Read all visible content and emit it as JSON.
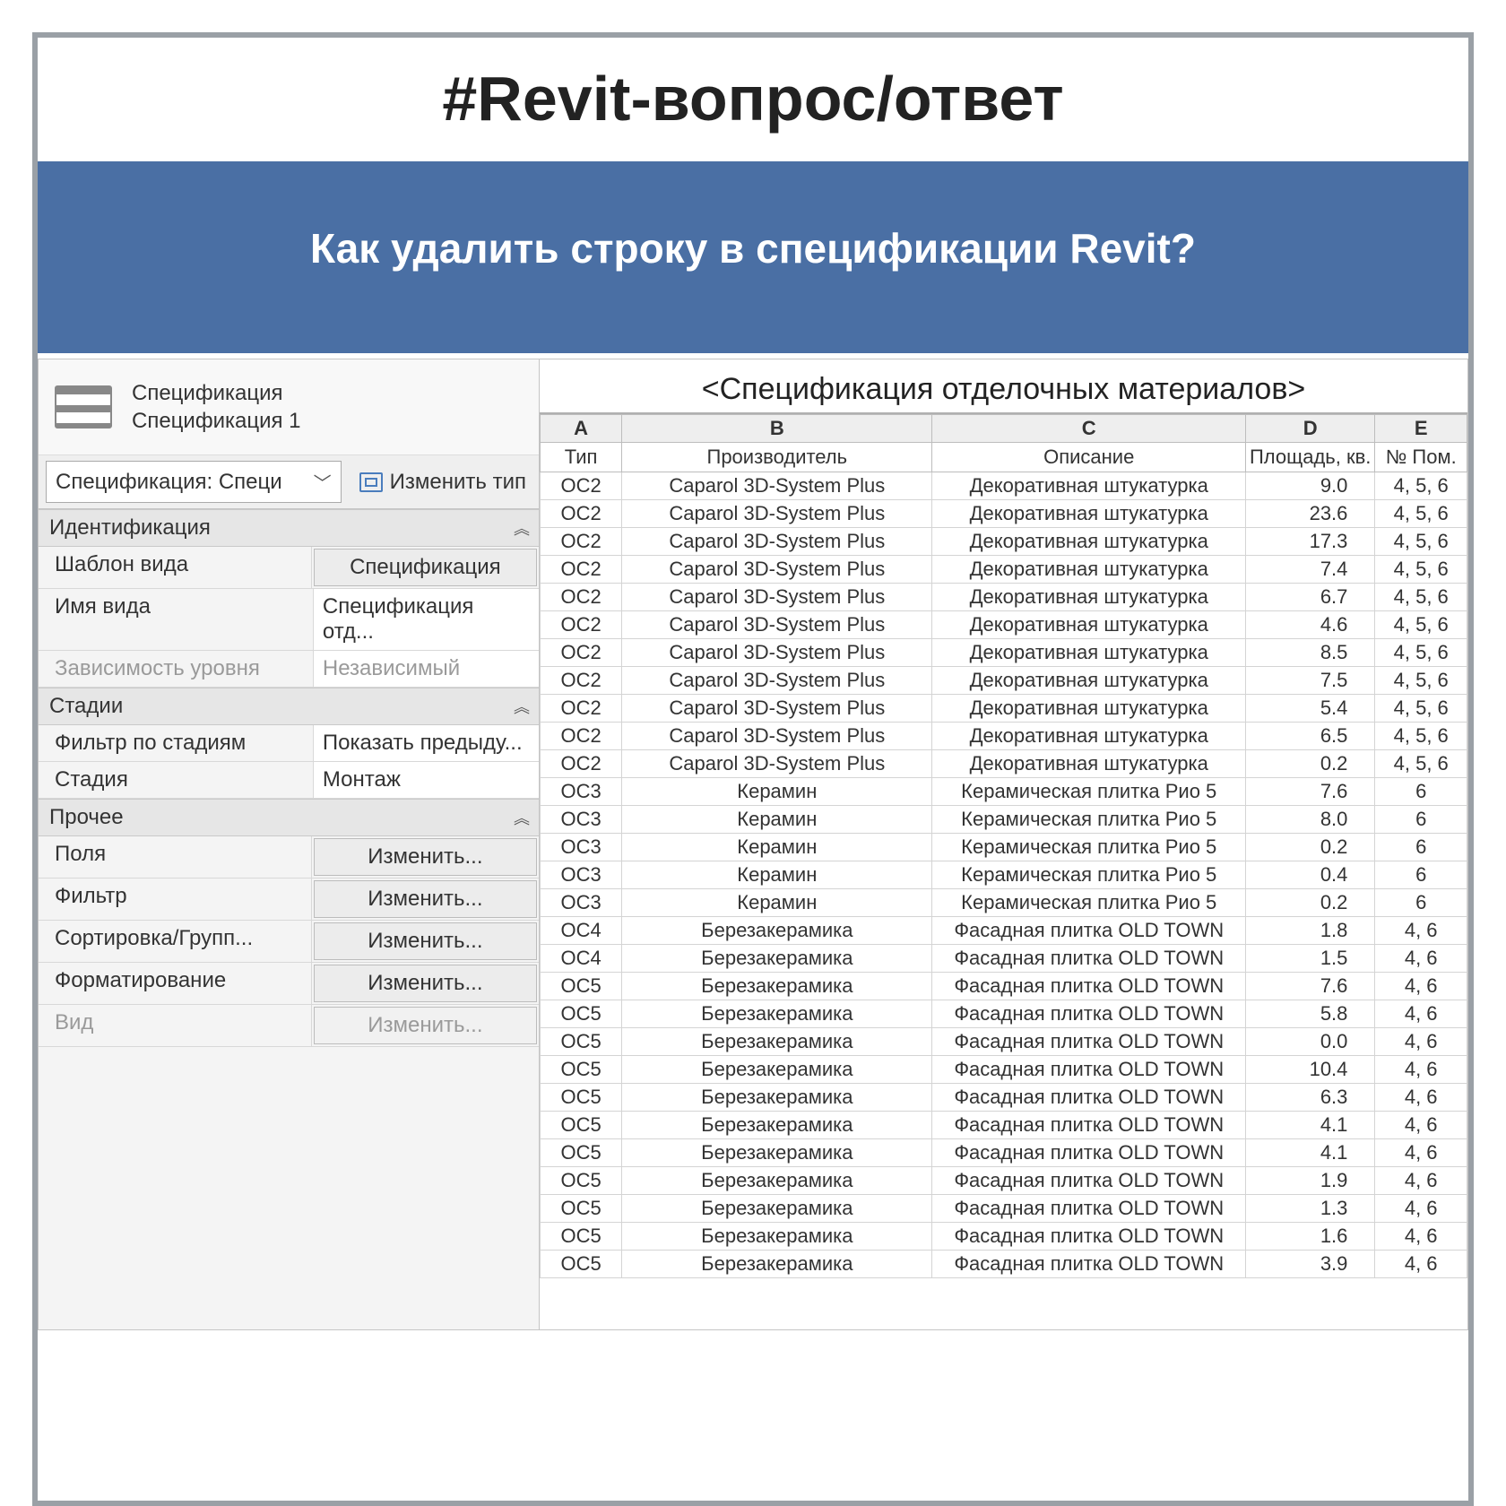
{
  "page_title": "#Revit-вопрос/ответ",
  "question": "Как удалить строку в спецификации Revit?",
  "props": {
    "header_line1": "Спецификация",
    "header_line2": "Спецификация 1",
    "type_selector": "Спецификация: Специ",
    "edit_type": "Изменить тип",
    "groups": [
      {
        "title": "Идентификация",
        "rows": [
          {
            "label": "Шаблон вида",
            "value": "Спецификация",
            "btn": true
          },
          {
            "label": "Имя вида",
            "value": "Спецификация отд..."
          },
          {
            "label": "Зависимость уровня",
            "value": "Независимый",
            "disabled": true
          }
        ]
      },
      {
        "title": "Стадии",
        "rows": [
          {
            "label": "Фильтр по стадиям",
            "value": "Показать предыду..."
          },
          {
            "label": "Стадия",
            "value": "Монтаж"
          }
        ]
      },
      {
        "title": "Прочее",
        "rows": [
          {
            "label": "Поля",
            "value": "Изменить...",
            "btn": true
          },
          {
            "label": "Фильтр",
            "value": "Изменить...",
            "btn": true
          },
          {
            "label": "Сортировка/Групп...",
            "value": "Изменить...",
            "btn": true
          },
          {
            "label": "Форматирование",
            "value": "Изменить...",
            "btn": true
          },
          {
            "label": "Вид",
            "value": "Изменить...",
            "btn": true,
            "disabled": true
          }
        ]
      }
    ]
  },
  "grid": {
    "title": "<Спецификация отделочных материалов>",
    "letters": [
      "A",
      "B",
      "C",
      "D",
      "E"
    ],
    "headers": [
      "Тип",
      "Производитель",
      "Описание",
      "Площадь, кв.",
      "№ Пом."
    ],
    "rows": [
      [
        "OC2",
        "Caparol 3D-System Plus",
        "Декоративная штукатурка",
        "9.0",
        "4, 5, 6"
      ],
      [
        "OC2",
        "Caparol 3D-System Plus",
        "Декоративная штукатурка",
        "23.6",
        "4, 5, 6"
      ],
      [
        "OC2",
        "Caparol 3D-System Plus",
        "Декоративная штукатурка",
        "17.3",
        "4, 5, 6"
      ],
      [
        "OC2",
        "Caparol 3D-System Plus",
        "Декоративная штукатурка",
        "7.4",
        "4, 5, 6"
      ],
      [
        "OC2",
        "Caparol 3D-System Plus",
        "Декоративная штукатурка",
        "6.7",
        "4, 5, 6"
      ],
      [
        "OC2",
        "Caparol 3D-System Plus",
        "Декоративная штукатурка",
        "4.6",
        "4, 5, 6"
      ],
      [
        "OC2",
        "Caparol 3D-System Plus",
        "Декоративная штукатурка",
        "8.5",
        "4, 5, 6"
      ],
      [
        "OC2",
        "Caparol 3D-System Plus",
        "Декоративная штукатурка",
        "7.5",
        "4, 5, 6"
      ],
      [
        "OC2",
        "Caparol 3D-System Plus",
        "Декоративная штукатурка",
        "5.4",
        "4, 5, 6"
      ],
      [
        "OC2",
        "Caparol 3D-System Plus",
        "Декоративная штукатурка",
        "6.5",
        "4, 5, 6"
      ],
      [
        "OC2",
        "Caparol 3D-System Plus",
        "Декоративная штукатурка",
        "0.2",
        "4, 5, 6"
      ],
      [
        "OC3",
        "Керамин",
        "Керамическая плитка Рио 5",
        "7.6",
        "6"
      ],
      [
        "OC3",
        "Керамин",
        "Керамическая плитка Рио 5",
        "8.0",
        "6"
      ],
      [
        "OC3",
        "Керамин",
        "Керамическая плитка Рио 5",
        "0.2",
        "6"
      ],
      [
        "OC3",
        "Керамин",
        "Керамическая плитка Рио 5",
        "0.4",
        "6"
      ],
      [
        "OC3",
        "Керамин",
        "Керамическая плитка Рио 5",
        "0.2",
        "6"
      ],
      [
        "OC4",
        "Березакерамика",
        "Фасадная плитка OLD TOWN",
        "1.8",
        "4, 6"
      ],
      [
        "OC4",
        "Березакерамика",
        "Фасадная плитка OLD TOWN",
        "1.5",
        "4, 6"
      ],
      [
        "OC5",
        "Березакерамика",
        "Фасадная плитка OLD TOWN",
        "7.6",
        "4, 6"
      ],
      [
        "OC5",
        "Березакерамика",
        "Фасадная плитка OLD TOWN",
        "5.8",
        "4, 6"
      ],
      [
        "OC5",
        "Березакерамика",
        "Фасадная плитка OLD TOWN",
        "0.0",
        "4, 6"
      ],
      [
        "OC5",
        "Березакерамика",
        "Фасадная плитка OLD TOWN",
        "10.4",
        "4, 6"
      ],
      [
        "OC5",
        "Березакерамика",
        "Фасадная плитка OLD TOWN",
        "6.3",
        "4, 6"
      ],
      [
        "OC5",
        "Березакерамика",
        "Фасадная плитка OLD TOWN",
        "4.1",
        "4, 6"
      ],
      [
        "OC5",
        "Березакерамика",
        "Фасадная плитка OLD TOWN",
        "4.1",
        "4, 6"
      ],
      [
        "OC5",
        "Березакерамика",
        "Фасадная плитка OLD TOWN",
        "1.9",
        "4, 6"
      ],
      [
        "OC5",
        "Березакерамика",
        "Фасадная плитка OLD TOWN",
        "1.3",
        "4, 6"
      ],
      [
        "OC5",
        "Березакерамика",
        "Фасадная плитка OLD TOWN",
        "1.6",
        "4, 6"
      ],
      [
        "OC5",
        "Березакерамика",
        "Фасадная плитка OLD TOWN",
        "3.9",
        "4, 6"
      ]
    ]
  }
}
